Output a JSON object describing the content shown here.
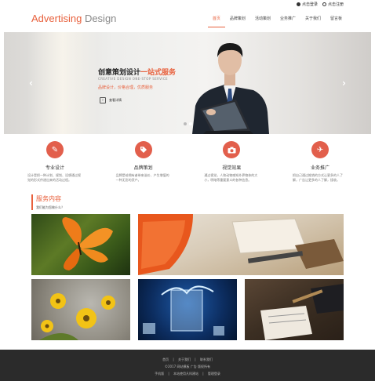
{
  "topbar": {
    "login": "点击登录",
    "register": "点击注册"
  },
  "logo": {
    "part1": "Advertising",
    "part2": "Design"
  },
  "nav": {
    "items": [
      "首页",
      "品牌策划",
      "活动策划",
      "业务推广",
      "关于我们",
      "留言板"
    ]
  },
  "banner": {
    "title_pre": "创意策划设计",
    "title_hl": "一站式服务",
    "subtitle": "CREATIVE DESIGN ONE-STOP SERVICE",
    "slogan": "品牌设计，价格合理，优质服务",
    "more": "查看详情"
  },
  "services": [
    {
      "name": "专业设计",
      "desc": "设计是把一种计划、规划、设想通过视觉的形式传递出来的活动过程。",
      "icon": "edit-icon"
    },
    {
      "name": "品牌策划",
      "desc": "品牌是给拥有者带来溢价、产生增值的一种无形的资产。",
      "icon": "tag-icon"
    },
    {
      "name": "视觉效果",
      "desc": "通过视觉，人和动物感知外界物体的大小，明暗等重要意义的各种信息。",
      "icon": "camera-icon"
    },
    {
      "name": "业务推广",
      "desc": "把自己通过推销的方式让更多的人了解，广告让更多的人了解，接收。",
      "icon": "plane-icon"
    }
  ],
  "section": {
    "title": "服务内容",
    "subtitle": "我们能为您做什么？"
  },
  "footer": {
    "links": [
      "首页",
      "关于我们",
      "联系我们"
    ],
    "copyright": "©2017 网站模板 广告 版权所有",
    "links2": [
      "手机版",
      "本站使用凡科建站",
      "管理登录"
    ]
  },
  "colors": {
    "accent": "#e8603c",
    "icon_bg": "#e25f4c",
    "footer_bg": "#2b2b2b"
  }
}
